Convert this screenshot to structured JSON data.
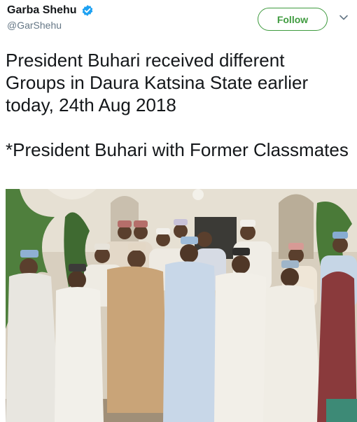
{
  "tweet": {
    "display_name": "Garba Shehu",
    "handle": "@GarShehu",
    "follow_label": "Follow",
    "text": "President Buhari received different Groups in Daura Katsina State earlier today, 24th Aug 2018\n\n*President Buhari with Former Classmates"
  },
  "icons": {
    "verified": "verified-badge-icon",
    "more": "chevron-down-icon"
  },
  "colors": {
    "follow_accent": "#3f9b3f",
    "verified_blue": "#1da1f2",
    "secondary_text": "#657786"
  }
}
